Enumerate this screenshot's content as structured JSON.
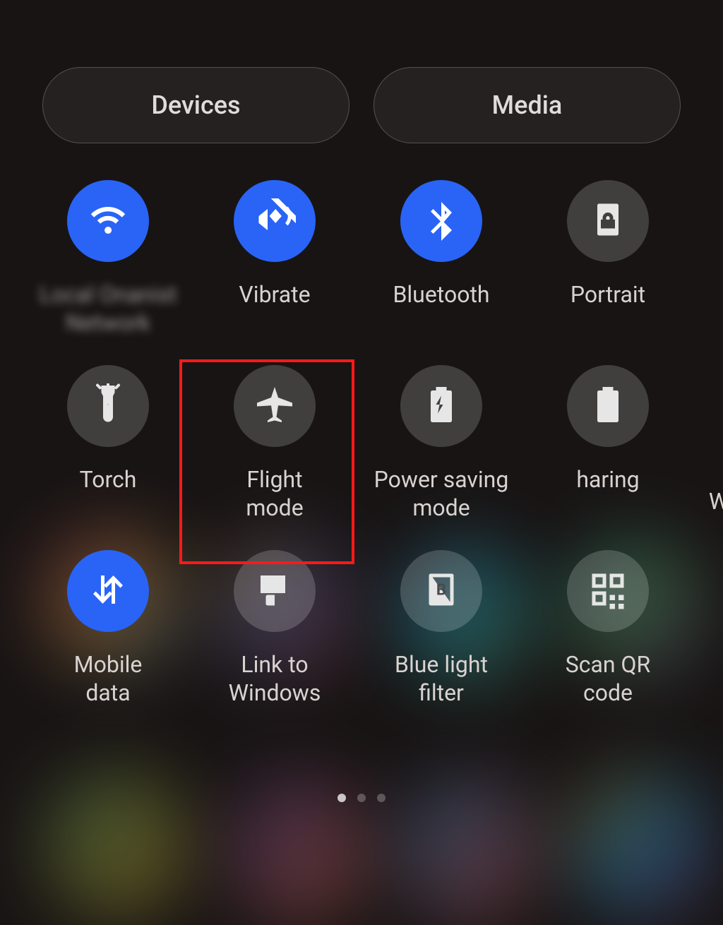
{
  "colors": {
    "accent_active": "#2964f6",
    "highlight": "#ff1a1a"
  },
  "top": {
    "devices_label": "Devices",
    "media_label": "Media"
  },
  "tiles": {
    "wifi": {
      "label": "Local Onanist\nNetwork",
      "active": true
    },
    "vibrate": {
      "label": "Vibrate",
      "active": true
    },
    "bluetooth": {
      "label": "Bluetooth",
      "active": true
    },
    "portrait": {
      "label": "Portrait",
      "active": false
    },
    "torch": {
      "label": "Torch",
      "active": false
    },
    "flight": {
      "label": "Flight\nmode",
      "active": false
    },
    "powersave": {
      "label": "Power saving\nmode",
      "active": false
    },
    "sharing": {
      "label": "haring",
      "active": false
    },
    "mobiledata": {
      "label": "Mobile\ndata",
      "active": true
    },
    "linkwindows": {
      "label": "Link to\nWindows",
      "active": false
    },
    "bluelight": {
      "label": "Blue light\nfilter",
      "active": false
    },
    "scanqr": {
      "label": "Scan QR\ncode",
      "active": false
    },
    "wifi_next": {
      "label": "Wi"
    }
  },
  "pager": {
    "count": 3,
    "active_index": 0
  }
}
